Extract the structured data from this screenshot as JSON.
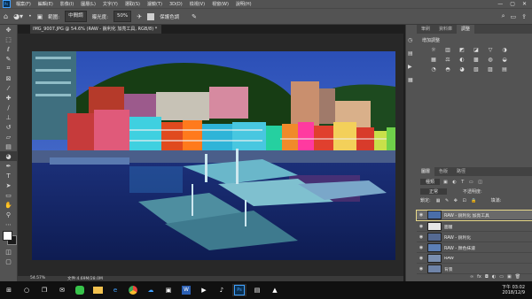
{
  "menubar": {
    "logo": "Ps",
    "items": [
      "檔案(F)",
      "編輯(E)",
      "影像(I)",
      "圖層(L)",
      "文字(Y)",
      "選取(S)",
      "濾鏡(T)",
      "3D(D)",
      "檢視(V)",
      "視窗(W)",
      "說明(H)"
    ],
    "controls": [
      "—",
      "▢",
      "✕"
    ]
  },
  "options": {
    "range_label": "範圍:",
    "range_value": "中間調",
    "exposure_label": "曝光度:",
    "exposure_value": "50%",
    "protect_tones_label": "保護色調"
  },
  "document": {
    "tab_title": "IMG_9007.JPG @ 54.6% (RAW - 銳利化 加亮工具, RGB/8) *",
    "zoom": "54.57%",
    "file_info": "文件:4.69M/28.0M"
  },
  "panels": {
    "top_tabs": [
      "筆刷",
      "資料庫",
      "調整"
    ],
    "adjustments_title": "增加調整",
    "adjust_icons": [
      "☼",
      "▥",
      "◩",
      "◪",
      "▽",
      "◑",
      "▦",
      "⚖",
      "◐",
      "▩",
      "◍",
      "◒",
      "◔",
      "◓",
      "◕",
      "▧",
      "▨",
      "▤"
    ],
    "layers_tabs": [
      "圖層",
      "色版",
      "路徑"
    ],
    "kind_label": "種類",
    "blend_mode": "正常",
    "opacity_label": "不透明度:",
    "lock_label": "鎖定:",
    "fill_label": "填滿:",
    "layers": [
      {
        "name": "RAW - 銳利化 加亮工具",
        "selected": true
      },
      {
        "name": "圖層",
        "selected": false
      },
      {
        "name": "RAW - 銳利化",
        "selected": false
      },
      {
        "name": "RAW - 顏色抹濾",
        "selected": false
      },
      {
        "name": "RAW",
        "selected": false
      },
      {
        "name": "背景",
        "selected": false
      }
    ],
    "bottom_icons": [
      "∞",
      "fx",
      "◘",
      "◐",
      "▭",
      "▣",
      "🗑"
    ]
  },
  "taskbar": {
    "time": "下午 03:02",
    "date": "2018/12/9"
  },
  "colors": {
    "accent_highlight": "#e8d98a",
    "ps_blue": "#3fa0ff"
  }
}
